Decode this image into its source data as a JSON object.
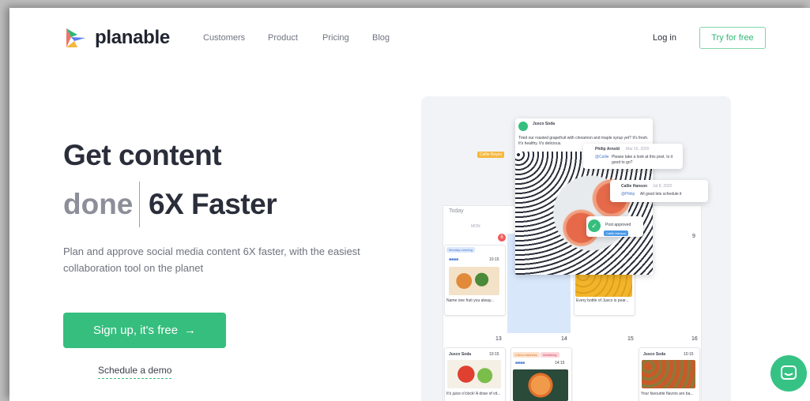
{
  "nav": {
    "brand": "planable",
    "links": [
      "Customers",
      "Product",
      "Pricing",
      "Blog"
    ],
    "login": "Log in",
    "try_free": "Try for free"
  },
  "hero": {
    "line1": "Get content",
    "line2_a": "done",
    "line2_b": "6X Faster",
    "subtitle": "Plan and approve social media content 6X faster, with the easiest collaboration tool on the planet",
    "cta": "Sign up, it's free",
    "cta_arrow": "→",
    "demo": "Schedule a demo"
  },
  "mockup": {
    "post": {
      "brand": "Jusco Soda",
      "caption": "Tried our roasted grapefruit with cinnamon and maple syrup yet? It's fresh. It's healthy. It's delicious."
    },
    "callie_tag": "Callie Reyes",
    "comment1": {
      "author": "Philip Arnold",
      "date": "Mar 16, 2020",
      "mention": "@Callie",
      "text": "Please take a look at this post. Is it good to go?"
    },
    "comment2": {
      "author": "Callie Hanson",
      "date": "Jul 8, 2020",
      "mention": "@Philip",
      "text": "All good lets schedule it"
    },
    "approved": "Post approved",
    "approved_tag": "Callie Hanson",
    "calendar": {
      "today": "Today",
      "day_label": "MON",
      "nums": {
        "red": "6",
        "n9": "9",
        "n13": "13",
        "n14": "14",
        "n15": "15",
        "n16": "16"
      },
      "card1": {
        "tag": "Monday morning",
        "time": "10:15",
        "text": "Name one fruit you alway..."
      },
      "card2": {
        "text": "Every bottle of Jusco is pear..."
      },
      "card3": {
        "brand": "Jusco Soda",
        "time": "10:15",
        "text": "It's juice o'clock! A dose of vit..."
      },
      "card4": {
        "tag1": "Citrus madness",
        "tag2": "Wellbeing",
        "time": "14:15"
      },
      "card5": {
        "brand": "Jusco Soda",
        "time": "10:15",
        "text": "Your favourite flavors are ba..."
      }
    }
  },
  "colors": {
    "accent": "#36be7e",
    "text": "#2a2e3a",
    "muted": "#8c8f99"
  }
}
